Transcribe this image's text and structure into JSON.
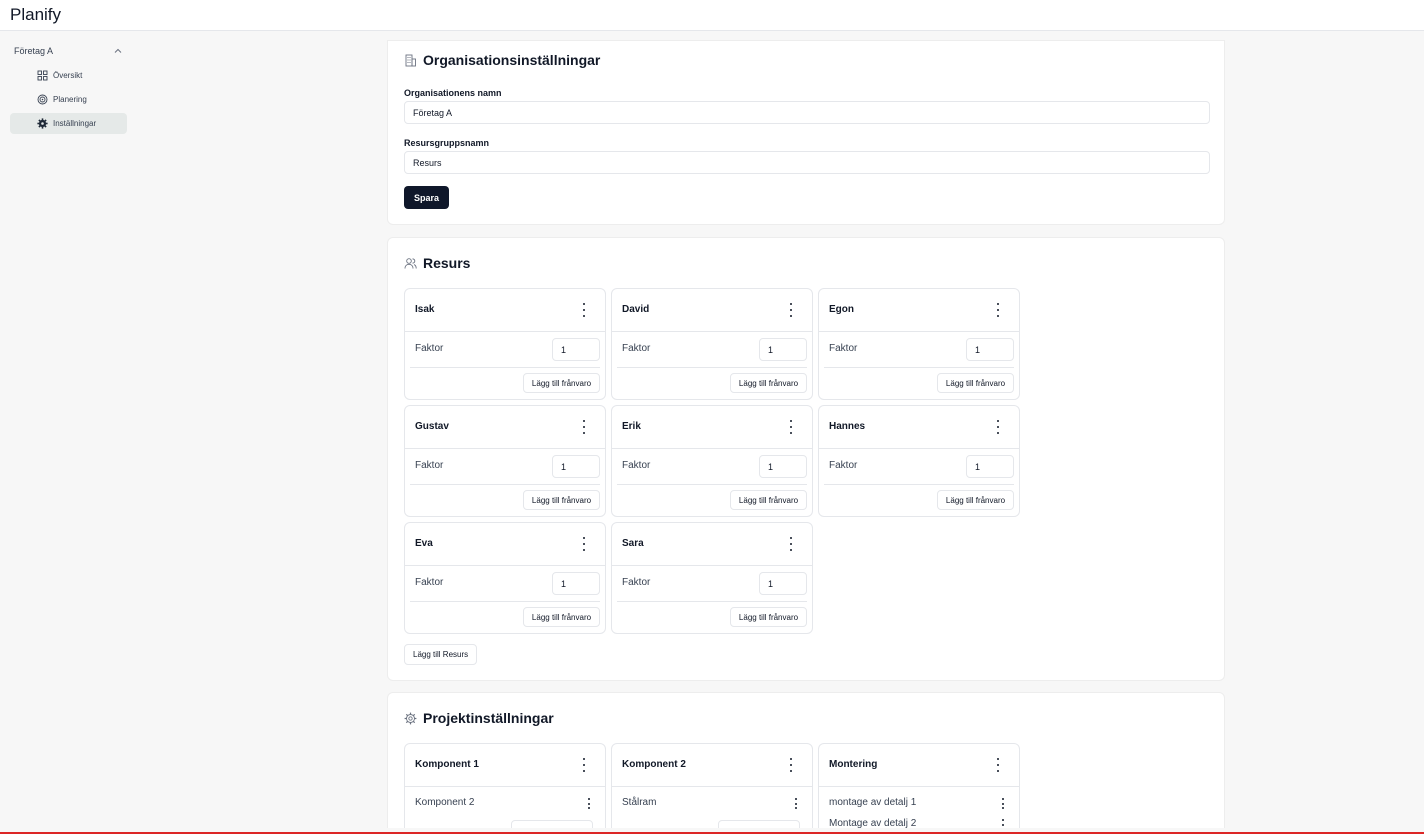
{
  "app": {
    "title": "Planify"
  },
  "sidebar": {
    "org": "Företag A",
    "items": [
      {
        "label": "Översikt",
        "icon": "grid-icon"
      },
      {
        "label": "Planering",
        "icon": "target-icon"
      },
      {
        "label": "Inställningar",
        "icon": "gear-icon",
        "active": true
      }
    ]
  },
  "org_settings": {
    "title": "Organisationsinställningar",
    "name_label": "Organisationens namn",
    "name_value": "Företag A",
    "group_label": "Resursgruppsnamn",
    "group_value": "Resurs",
    "save_label": "Spara"
  },
  "resources": {
    "title": "Resurs",
    "factor_label": "Faktor",
    "absence_label": "Lägg till frånvaro",
    "add_label": "Lägg till Resurs",
    "items": [
      {
        "name": "Isak",
        "factor": "1"
      },
      {
        "name": "David",
        "factor": "1"
      },
      {
        "name": "Egon",
        "factor": "1"
      },
      {
        "name": "Gustav",
        "factor": "1"
      },
      {
        "name": "Erik",
        "factor": "1"
      },
      {
        "name": "Hannes",
        "factor": "1"
      },
      {
        "name": "Eva",
        "factor": "1"
      },
      {
        "name": "Sara",
        "factor": "1"
      }
    ]
  },
  "project_settings": {
    "title": "Projektinställningar",
    "items": [
      {
        "name": "Komponent 1",
        "rows": [
          "Komponent 2"
        ]
      },
      {
        "name": "Komponent 2",
        "rows": [
          "Stålram"
        ]
      },
      {
        "name": "Montering",
        "rows": [
          "montage av detalj 1",
          "Montage av detalj 2"
        ]
      }
    ]
  }
}
